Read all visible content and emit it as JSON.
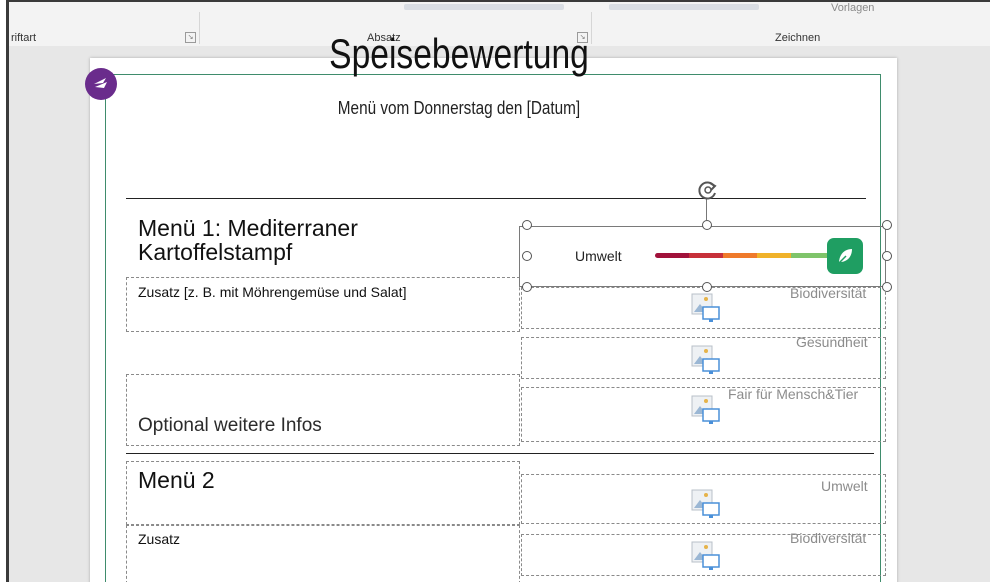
{
  "ribbon": {
    "schriftart": "riftart",
    "absatz": "Absatz",
    "zeichnen": "Zeichnen",
    "vorlagen": "Vorlagen"
  },
  "document": {
    "title": "Speisebewertung",
    "subtitle": "Menü vom Donnerstag den [Datum]",
    "menu1": {
      "heading_line1": "Menü 1: Mediterraner",
      "heading_line2": "Kartoffelstampf",
      "zusatz": "Zusatz [z. B. mit Möhrengemüse und Salat]",
      "optional": "Optional weitere Infos"
    },
    "menu2": {
      "heading": "Menü 2",
      "zusatz": "Zusatz"
    },
    "ratings1": {
      "umwelt": "Umwelt",
      "biodiversitaet": "Biodiversität",
      "gesundheit": "Gesundheit",
      "fair": "Fair für Mensch&Tier"
    },
    "ratings2": {
      "umwelt": "Umwelt",
      "biodiversitaet": "Biodiversität"
    }
  },
  "colors": {
    "accent": "#1f9e62",
    "logo": "#6a2c8c",
    "scale": [
      "#a1123b",
      "#c7303a",
      "#ef7a2b",
      "#f0b22a",
      "#7fc46a",
      "#1f9e62"
    ]
  },
  "icons": [
    "rotate-handle-icon",
    "leaf-icon",
    "image-placeholder-icon",
    "dialog-launcher-icon",
    "logo-icon"
  ]
}
